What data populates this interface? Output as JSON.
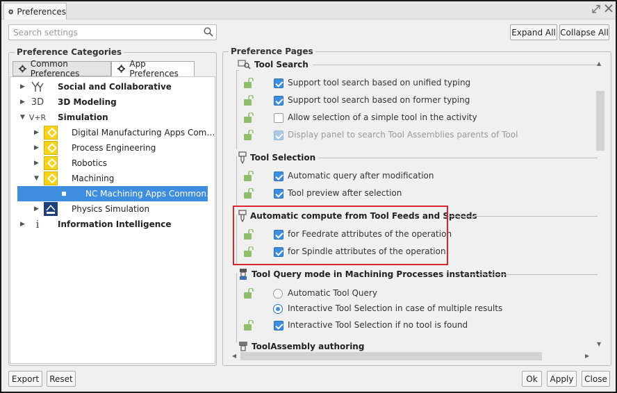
{
  "window": {
    "title": "Preferences"
  },
  "search": {
    "placeholder": "Search settings"
  },
  "toolbar": {
    "expand_all": "Expand All",
    "collapse_all": "Collapse All"
  },
  "left": {
    "group_title": "Preference Categories",
    "tabs": [
      {
        "label": "Common Preferences",
        "icon": "gear-icon"
      },
      {
        "label": "App Preferences",
        "icon": "gear-icon",
        "active": true
      }
    ],
    "tree": [
      {
        "label": "Social and Collaborative",
        "icon": "social-icon",
        "icon_text": "",
        "bold": true,
        "level": 0,
        "expanded": false
      },
      {
        "label": "3D Modeling",
        "icon": "3d-icon",
        "icon_text": "3D",
        "bold": true,
        "level": 0,
        "expanded": false
      },
      {
        "label": "Simulation",
        "icon": "simulation-icon",
        "icon_text": "V+R",
        "bold": true,
        "level": 0,
        "expanded": true
      },
      {
        "label": "Digital Manufacturing Apps Com…",
        "icon": "app-icon",
        "bold": false,
        "level": 1,
        "expanded": false
      },
      {
        "label": "Process Engineering",
        "icon": "app-icon",
        "bold": false,
        "level": 1,
        "expanded": false
      },
      {
        "label": "Robotics",
        "icon": "app-icon",
        "bold": false,
        "level": 1,
        "expanded": false
      },
      {
        "label": "Machining",
        "icon": "app-icon",
        "bold": false,
        "level": 1,
        "expanded": true
      },
      {
        "label": "NC Machining Apps Common…",
        "icon": "page-icon",
        "bold": false,
        "level": 2,
        "selected": true
      },
      {
        "label": "Physics Simulation",
        "icon": "physics-icon",
        "bold": false,
        "level": 1,
        "expanded": false
      },
      {
        "label": "Information Intelligence",
        "icon": "info-icon",
        "icon_text": "i",
        "bold": true,
        "level": 0,
        "expanded": false
      }
    ]
  },
  "right": {
    "group_title": "Preference Pages",
    "sections": [
      {
        "title": "Tool Search",
        "icon": "tool-search-icon",
        "options": [
          {
            "label": "Support tool search based on unified typing",
            "type": "checkbox",
            "checked": true,
            "enabled": true
          },
          {
            "label": "Support tool search based on former typing",
            "type": "checkbox",
            "checked": true,
            "enabled": true
          },
          {
            "label": "Allow selection of a simple tool in the activity",
            "type": "checkbox",
            "checked": false,
            "enabled": true
          },
          {
            "label": "Display panel to search Tool Assemblies parents of Tool",
            "type": "checkbox",
            "checked": true,
            "enabled": false
          }
        ]
      },
      {
        "title": "Tool Selection",
        "icon": "tool-icon",
        "options": [
          {
            "label": "Automatic query after modification",
            "type": "checkbox",
            "checked": true,
            "enabled": true
          },
          {
            "label": "Tool preview after selection",
            "type": "checkbox",
            "checked": true,
            "enabled": true
          }
        ]
      },
      {
        "title": "Automatic compute from Tool Feeds and Speeds",
        "icon": "tool-icon",
        "options": [
          {
            "label": "for Feedrate attributes of the operation",
            "type": "checkbox",
            "checked": true,
            "enabled": true
          },
          {
            "label": "for Spindle attributes of the operation",
            "type": "checkbox",
            "checked": true,
            "enabled": true
          }
        ]
      },
      {
        "title": "Tool Query mode in Machining Processes instantiation",
        "icon": "tool-query-icon",
        "options": [
          {
            "label": "Automatic Tool Query",
            "type": "radio",
            "checked": false,
            "enabled": true
          },
          {
            "label": "Interactive Tool Selection in case of multiple results",
            "type": "radio",
            "checked": true,
            "enabled": true
          },
          {
            "label": "Interactive Tool Selection if no tool is found",
            "type": "checkbox",
            "checked": true,
            "enabled": true
          }
        ]
      },
      {
        "title": "ToolAssembly authoring",
        "icon": "tool-assembly-icon",
        "options": []
      }
    ]
  },
  "footer": {
    "export": "Export",
    "reset": "Reset",
    "ok": "Ok",
    "apply": "Apply",
    "close": "Close"
  },
  "colors": {
    "accent": "#3d8ede",
    "highlight_box": "#d9262c",
    "app_icon": "#f7d417"
  }
}
